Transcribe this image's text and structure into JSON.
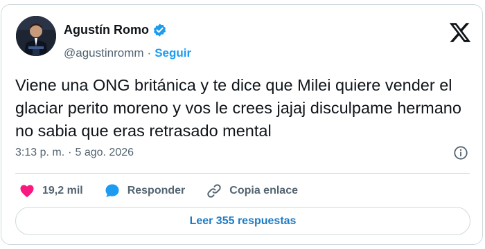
{
  "author": {
    "name": "Agustín Romo",
    "handle": "@agustinromm",
    "separator": "·",
    "follow_label": "Seguir",
    "verified_icon": "verified-badge-icon"
  },
  "tweet": {
    "text": "Viene una ONG británica y te dice que Milei quiere vender el glaciar perito moreno y vos le crees jajaj disculpame hermano no sabia que eras retrasado mental",
    "time": "3:13 p. m.",
    "separator": "·",
    "date": "5 ago. 2026"
  },
  "actions": {
    "likes": "19,2 mil",
    "reply_label": "Responder",
    "copy_label": "Copia enlace"
  },
  "read_replies_label": "Leer 355 respuestas",
  "colors": {
    "accent": "#1d9bf0",
    "heart": "#f91880",
    "text_secondary": "#536471",
    "border": "#cfd9de"
  }
}
